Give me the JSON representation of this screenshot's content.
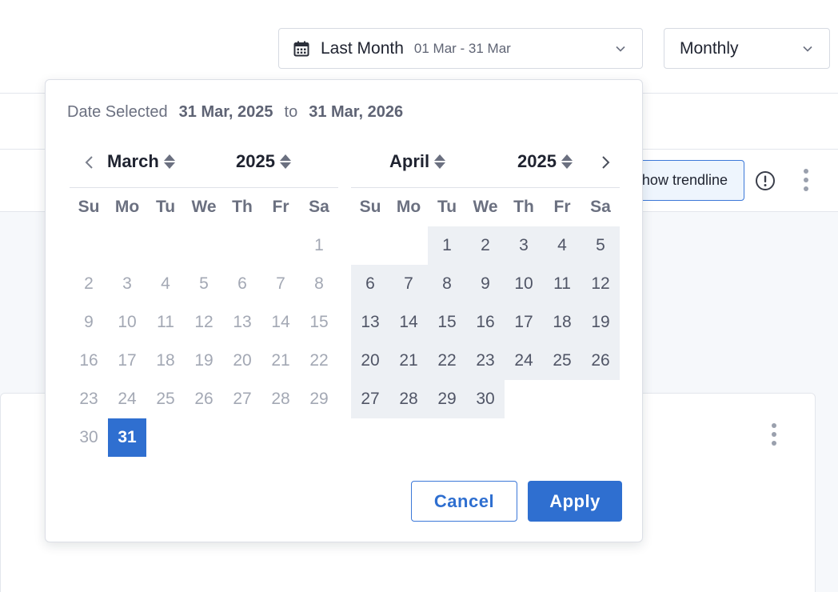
{
  "toolbar": {
    "date_preset": "Last Month",
    "date_range": "01 Mar - 31 Mar",
    "interval": "Monthly"
  },
  "chart_controls": {
    "trendline_label": "how trendline"
  },
  "picker": {
    "summary_label": "Date Selected",
    "start_date": "31 Mar, 2025",
    "to_label": "to",
    "end_date": "31 Mar, 2026",
    "weekdays": [
      "Su",
      "Mo",
      "Tu",
      "We",
      "Th",
      "Fr",
      "Sa"
    ],
    "left": {
      "month": "March",
      "year": "2025",
      "lead_blanks": 6,
      "days": [
        "1",
        "2",
        "3",
        "4",
        "5",
        "6",
        "7",
        "8",
        "9",
        "10",
        "11",
        "12",
        "13",
        "14",
        "15",
        "16",
        "17",
        "18",
        "19",
        "20",
        "21",
        "22",
        "23",
        "24",
        "25",
        "26",
        "27",
        "28",
        "29",
        "30",
        "31"
      ],
      "selected_day": "31",
      "in_range_from": null
    },
    "right": {
      "month": "April",
      "year": "2025",
      "lead_blanks": 2,
      "days": [
        "1",
        "2",
        "3",
        "4",
        "5",
        "6",
        "7",
        "8",
        "9",
        "10",
        "11",
        "12",
        "13",
        "14",
        "15",
        "16",
        "17",
        "18",
        "19",
        "20",
        "21",
        "22",
        "23",
        "24",
        "25",
        "26",
        "27",
        "28",
        "29",
        "30"
      ],
      "selected_day": null,
      "in_range_from": "1"
    },
    "cancel_label": "Cancel",
    "apply_label": "Apply"
  },
  "colors": {
    "accent": "#2f6fd0",
    "range_fill": "#edf0f4"
  }
}
